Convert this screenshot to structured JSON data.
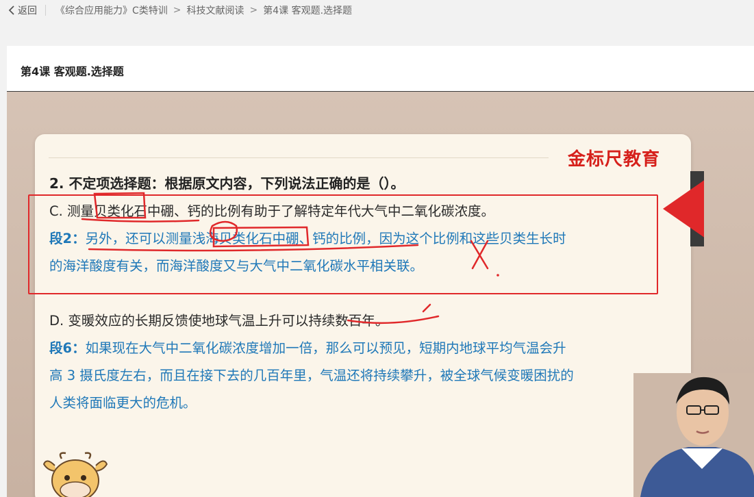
{
  "topbar": {
    "back_label": "返回",
    "breadcrumbs": [
      "《综合应用能力》C类特训",
      "科技文献阅读",
      "第4课 客观题.选择题"
    ],
    "separator": ">"
  },
  "header": {
    "title": "第4课 客观题.选择题"
  },
  "slide": {
    "brand": "金标尺教育",
    "question": "2. 不定项选择题：根据原文内容，下列说法正确的是（）。",
    "option_c": "C. 测量贝类化石中硼、钙的比例有助于了解特定年代大气中二氧化碳浓度。",
    "para2_label": "段2：",
    "para2_line1": "另外，还可以测量浅海贝类化石中硼、钙的比例，因为这个比例和这些贝类生长时",
    "para2_line2": "的海洋酸度有关，而海洋酸度又与大气中二氧化碳水平相关联。",
    "option_d": "D. 变暖效应的长期反馈使地球气温上升可以持续数百年。",
    "para6_label": "段6：",
    "para6_line1": "如果现在大气中二氧化碳浓度增加一倍，那么可以预见，短期内地球平均气温会升",
    "para6_line2": "高 3 摄氏度左右，而且在接下去的几百年里，气温还将持续攀升，被全球气候变暖困扰的",
    "para6_line3": "人类将面临更大的危机。"
  },
  "colors": {
    "accent_red": "#e0282a",
    "text_blue": "#1f78b8",
    "brand_red": "#d6201b"
  }
}
